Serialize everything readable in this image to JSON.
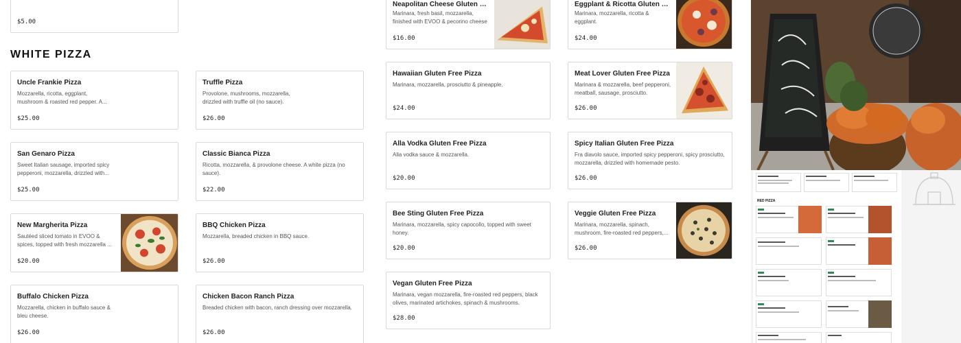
{
  "left_column_top": {
    "price": "$5.00"
  },
  "white_pizza": {
    "heading": "WHITE PIZZA",
    "items": [
      {
        "title": "Uncle Frankie Pizza",
        "desc": "Mozzarella, ricotta, eggplant, mushroom & roasted red pepper. A...",
        "price": "$25.00"
      },
      {
        "title": "Truffle Pizza",
        "desc": "Provolone, mushrooms, mozzarella, drizzled with truffle oil (no sauce).",
        "price": "$26.00"
      },
      {
        "title": "San Genaro Pizza",
        "desc": "Sweet Italian sausage, imported spicy pepperoni, mozzarella, drizzled with...",
        "price": "$25.00"
      },
      {
        "title": "Classic Bianca Pizza",
        "desc": "Ricotta, mozzarella, & provolone cheese. A white pizza (no sauce).",
        "price": "$22.00"
      },
      {
        "title": "New Margherita Pizza",
        "desc": "Sautéed sliced tomato in EVOO & spices, topped with fresh mozzarella ...",
        "price": "$20.00"
      },
      {
        "title": "BBQ Chicken Pizza",
        "desc": "Mozzarella, breaded chicken in BBQ sauce.",
        "price": "$26.00"
      },
      {
        "title": "Buffalo Chicken Pizza",
        "desc": "Mozzarella, chicken in buffalo sauce & bleu cheese.",
        "price": "$26.00"
      },
      {
        "title": "Chicken Bacon Ranch Pizza",
        "desc": "Breaded chicken with bacon, ranch dressing over mozzarella.",
        "price": "$26.00"
      }
    ]
  },
  "gluten_free": {
    "items": [
      {
        "title": "Neapolitan Cheese Gluten Free...",
        "desc": "Marinara, fresh basil, mozzarella, finished with EVOO & pecorino cheese",
        "price": "$16.00"
      },
      {
        "title": "Eggplant & Ricotta Gluten Free...",
        "desc": "Marinara, mozzarella, ricotta & eggplant.",
        "price": "$24.00"
      },
      {
        "title": "Hawaiian Gluten Free Pizza",
        "desc": "Marinara, mozzarella, prosciutto & pineapple.",
        "price": "$24.00"
      },
      {
        "title": "Meat Lover Gluten Free Pizza",
        "desc": "Marinara & mozzarella, beef pepperoni, meatball, sausage, prosciutto.",
        "price": "$26.00"
      },
      {
        "title": "Alla Vodka Gluten Free Pizza",
        "desc": "Alla vodka sauce & mozzarella.",
        "price": "$20.00"
      },
      {
        "title": "Spicy Italian Gluten Free Pizza",
        "desc": "Fra diavolo sauce, imported spicy pepperoni, spicy prosciutto, mozzarella, drizzled with homemade pesto.",
        "price": "$26.00"
      },
      {
        "title": "Bee Sting Gluten Free Pizza",
        "desc": "Marinara, mozzarella, spicy capocollo, topped with sweet honey.",
        "price": "$20.00"
      },
      {
        "title": "Veggie Gluten Free Pizza",
        "desc": "Marinara, mozzarella, spinach, mushroom, fire-roasted red peppers,...",
        "price": "$26.00"
      },
      {
        "title": "Vegan Gluten Free Pizza",
        "desc": "Marinara, vegan mozzarella, fire-roasted red peppers, black olives, marinated artichokes, spinach & mushrooms.",
        "price": "$28.00"
      }
    ]
  },
  "mini_preview": {
    "heading": "RED PIZZA"
  },
  "colors": {
    "badge": "#2e8b57",
    "border": "#d9d9d9"
  }
}
